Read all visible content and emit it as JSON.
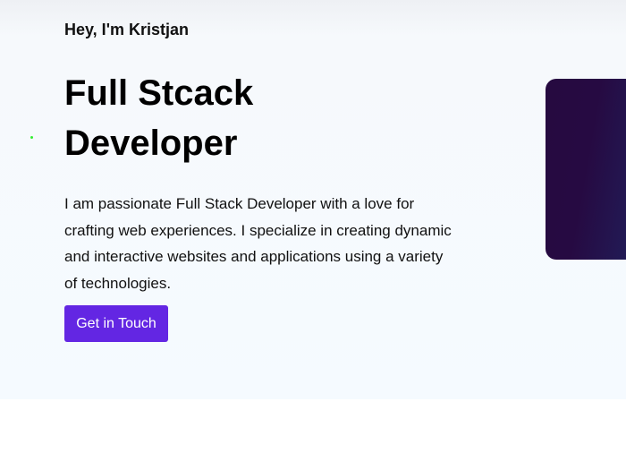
{
  "hero": {
    "greeting": "Hey, I'm Kristjan",
    "title_line1": "Full Stcack",
    "title_line2": "Developer",
    "description": "I am passionate Full Stack Developer with a love for crafting web experiences. I specialize in creating dynamic and interactive websites and applications using a variety of technologies.",
    "cta_label": "Get in Touch"
  },
  "colors": {
    "accent": "#6326e3",
    "card": "#260a40"
  }
}
